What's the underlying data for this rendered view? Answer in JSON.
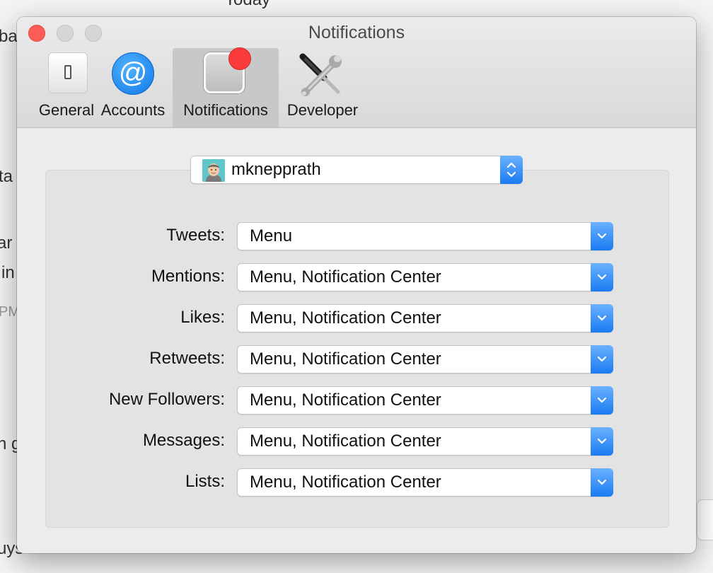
{
  "background": {
    "fragments": [
      "Today",
      "ba",
      "ta",
      "ar",
      "in",
      "PM",
      "n g",
      "uys"
    ]
  },
  "window": {
    "title": "Notifications"
  },
  "toolbar": {
    "items": [
      {
        "label": "General",
        "icon": "switch-icon"
      },
      {
        "label": "Accounts",
        "icon": "at-sign-icon"
      },
      {
        "label": "Notifications",
        "icon": "notification-badge-icon",
        "selected": true
      },
      {
        "label": "Developer",
        "icon": "tools-icon"
      }
    ]
  },
  "account": {
    "selected": "mknepprath",
    "at_symbol": "@"
  },
  "settings": {
    "rows": [
      {
        "label": "Tweets:",
        "value": "Menu"
      },
      {
        "label": "Mentions:",
        "value": "Menu, Notification Center"
      },
      {
        "label": "Likes:",
        "value": "Menu, Notification Center"
      },
      {
        "label": "Retweets:",
        "value": "Menu, Notification Center"
      },
      {
        "label": "New Followers:",
        "value": "Menu, Notification Center"
      },
      {
        "label": "Messages:",
        "value": "Menu, Notification Center"
      },
      {
        "label": "Lists:",
        "value": "Menu, Notification Center"
      }
    ]
  },
  "colors": {
    "accent": "#1a7bf2",
    "close_button": "#fc5e57",
    "badge": "#fc3b3b"
  }
}
